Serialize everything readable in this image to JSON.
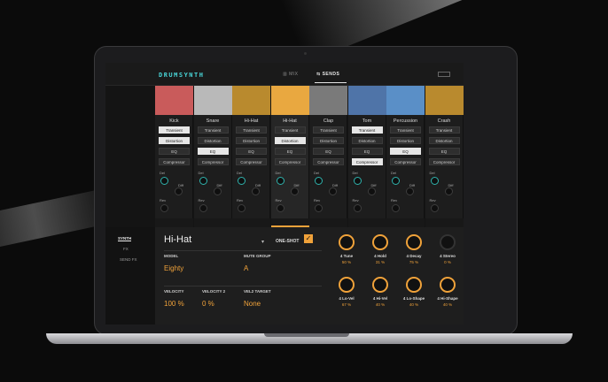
{
  "app": {
    "logo": "DRUMSYNTH",
    "tabs": [
      {
        "label": "MIX",
        "active": false
      },
      {
        "label": "SENDS",
        "active": true
      }
    ],
    "accent": "#f0a23a",
    "teal": "#2fb3ad"
  },
  "channels": [
    {
      "name": "Kick",
      "color": "#c95b5b",
      "fx": [
        true,
        true,
        false,
        false
      ],
      "selected": false
    },
    {
      "name": "Snare",
      "color": "#b9b9b9",
      "fx": [
        false,
        false,
        true,
        false
      ],
      "selected": false
    },
    {
      "name": "Hi-Hat",
      "color": "#b98a2e",
      "fx": [
        false,
        false,
        false,
        false
      ],
      "selected": false
    },
    {
      "name": "Hi-Hat",
      "color": "#e9a840",
      "fx": [
        false,
        true,
        false,
        false
      ],
      "selected": true
    },
    {
      "name": "Clap",
      "color": "#7a7a7a",
      "fx": [
        false,
        false,
        false,
        false
      ],
      "selected": false
    },
    {
      "name": "Tom",
      "color": "#4f74a8",
      "fx": [
        true,
        false,
        false,
        true
      ],
      "selected": false
    },
    {
      "name": "Percussion",
      "color": "#5a8fc7",
      "fx": [
        false,
        false,
        true,
        false
      ],
      "selected": false
    },
    {
      "name": "Crash",
      "color": "#b98a2e",
      "fx": [
        false,
        false,
        false,
        false
      ],
      "selected": false
    }
  ],
  "fx_labels": [
    "Transient",
    "Distortion",
    "EQ",
    "Compressor"
  ],
  "send_labels": {
    "del": "Del",
    "diff": "Diff",
    "rev": "Rev"
  },
  "sidebar": {
    "items": [
      {
        "label": "SYNTH",
        "active": true
      },
      {
        "label": "FX",
        "active": false
      },
      {
        "label": "SEND FX",
        "active": false
      }
    ]
  },
  "detail": {
    "instrument": "Hi-Hat",
    "dropdown": "▾",
    "oneshot_label": "ONE-SHOT",
    "oneshot_checked": "✓",
    "model_label": "MODEL",
    "model_value": "Eighty",
    "mute_label": "MUTE GROUP",
    "mute_value": "A",
    "velocity_label": "VELOCITY",
    "velocity_value": "100 %",
    "velocity2_label": "VELOCITY 2",
    "velocity2_value": "0 %",
    "vel2_target_label": "VEL2 TARGET",
    "vel2_target_value": "None"
  },
  "macros": [
    {
      "label": "4 Tune",
      "value": "50 %",
      "on": true
    },
    {
      "label": "4 Hold",
      "value": "31 %",
      "on": true
    },
    {
      "label": "4 Decay",
      "value": "75 %",
      "on": true
    },
    {
      "label": "4 Stereo",
      "value": "0 %",
      "on": false
    },
    {
      "label": "4 Lo-Vel",
      "value": "67 %",
      "on": true
    },
    {
      "label": "4 Hi-Vel",
      "value": "40 %",
      "on": true
    },
    {
      "label": "4 Lo-Shape",
      "value": "40 %",
      "on": true
    },
    {
      "label": "4 Hi-Shape",
      "value": "40 %",
      "on": true
    }
  ]
}
